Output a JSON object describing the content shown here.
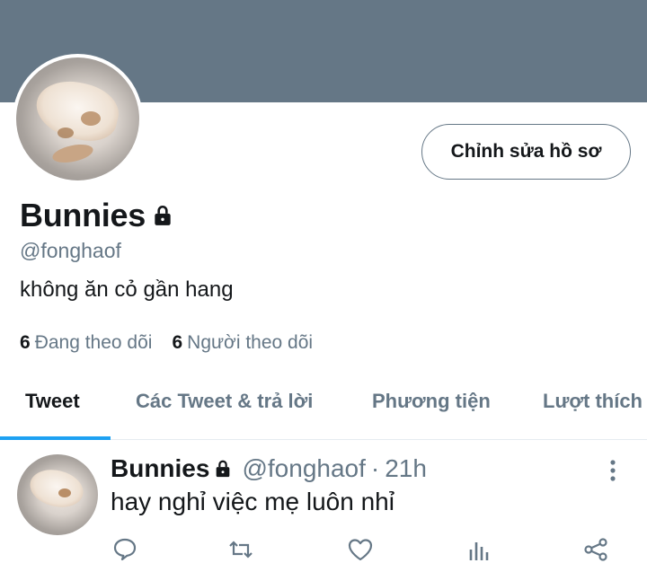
{
  "profile": {
    "display_name": "Bunnies",
    "handle": "@fonghaof",
    "bio": "không ăn cỏ gần hang",
    "edit_button_label": "Chỉnh sửa hồ sơ",
    "following_count": "6",
    "following_label": "Đang theo dõi",
    "followers_count": "6",
    "followers_label": "Người theo dõi",
    "locked": true
  },
  "tabs": [
    {
      "label": "Tweet",
      "active": true
    },
    {
      "label": "Các Tweet & trả lời",
      "active": false
    },
    {
      "label": "Phương tiện",
      "active": false
    },
    {
      "label": "Lượt thích",
      "active": false
    }
  ],
  "tweet": {
    "name": "Bunnies",
    "handle": "@fonghaof",
    "separator": "·",
    "time": "21h",
    "text": "hay nghỉ việc mẹ luôn nhỉ",
    "actions": [
      "reply-icon",
      "retweet-icon",
      "like-icon",
      "analytics-icon",
      "share-icon"
    ]
  },
  "colors": {
    "banner": "#657786",
    "accent": "#1da1f2",
    "secondary_text": "#657786",
    "primary_text": "#14171a"
  }
}
